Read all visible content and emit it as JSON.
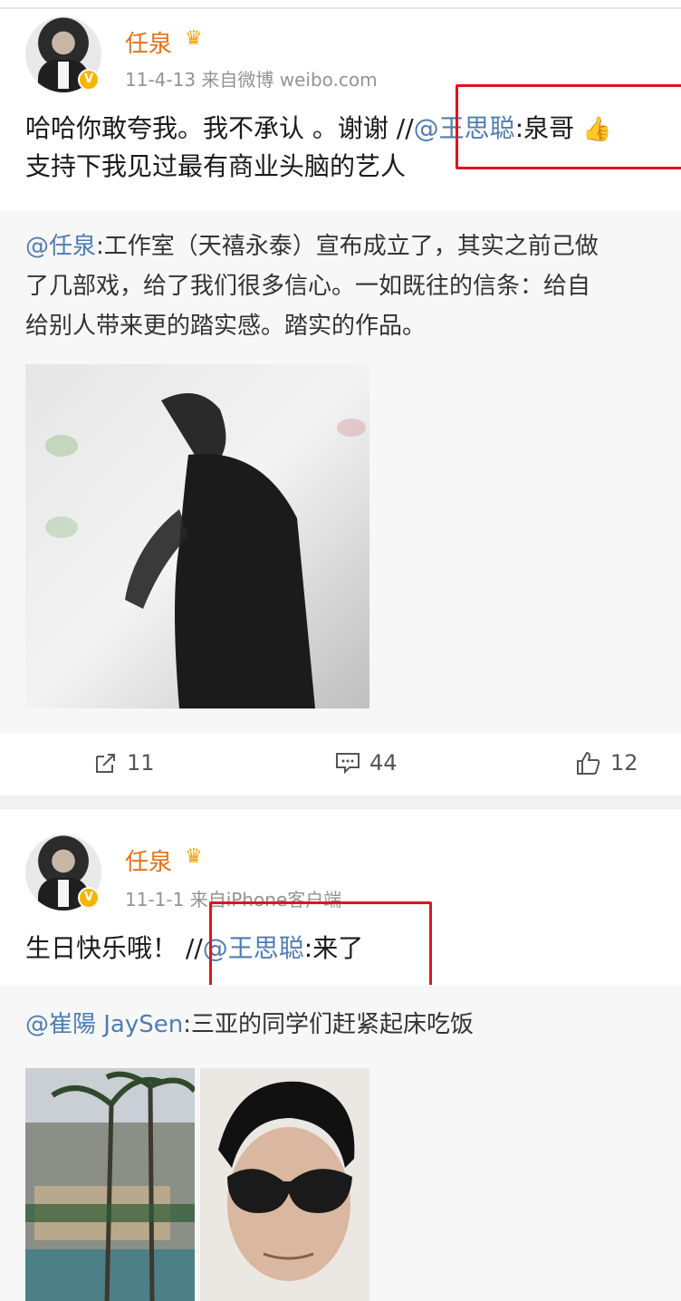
{
  "posts": [
    {
      "user": "任泉",
      "crown": "♛",
      "meta": "11-4-13  来自微博 weibo.com",
      "text_line1_a": "哈哈你敢夸我。我不承认 。谢谢 //",
      "text_line1_mention": "@王思聪",
      "text_line1_b": ":泉哥",
      "text_line1_emoji": "👍",
      "text_line2": "支持下我见过最有商业头脑的艺人",
      "repost_mention": "@任泉",
      "repost_line1": ":工作室（天禧永泰）宣布成立了，其实之前己做",
      "repost_line2": "了几部戏，给了我们很多信心。一如既往的信条：给自",
      "repost_line3": "给别人带来更的踏实感。踏实的作品。",
      "actions": {
        "share": "11",
        "comment": "44",
        "like": "12"
      }
    },
    {
      "user": "任泉",
      "crown": "♛",
      "meta": "11-1-1  来自iPhone客户端",
      "text_a": "生日快乐哦！ //",
      "text_mention": "@王思聪",
      "text_b": ":来了",
      "repost_mention": "@崔陽 JaySen",
      "repost_text": ":三亚的同学们赶紧起床吃饭"
    }
  ],
  "icons": {
    "verified": "V"
  },
  "colors": {
    "username": "#e8711a",
    "mention": "#4f7db3",
    "highlight_box": "#e0141e"
  }
}
